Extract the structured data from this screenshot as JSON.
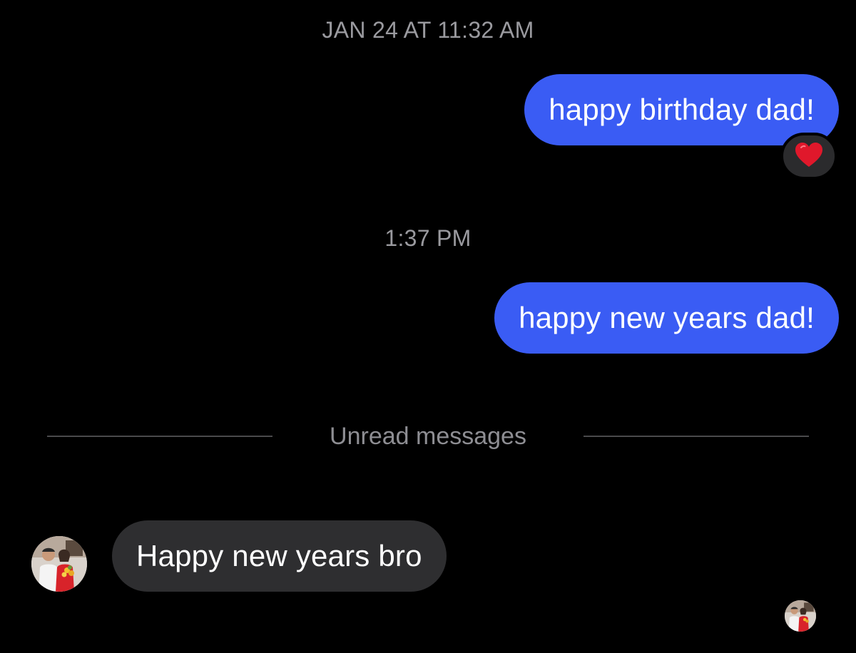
{
  "conversation": {
    "timestamps": [
      "JAN 24 AT 11:32 AM",
      "1:37 PM"
    ],
    "outgoing": [
      {
        "text": "happy birthday dad!",
        "reaction": "heart"
      },
      {
        "text": "happy new years dad!"
      }
    ],
    "divider_label": "Unread messages",
    "incoming": [
      {
        "text": "Happy new years bro"
      }
    ]
  },
  "colors": {
    "outgoing_bubble": "#3a5cf4",
    "incoming_bubble": "#2e2e30",
    "background": "#000000",
    "timestamp": "#9a9a9f",
    "reaction_heart": "#e0182b"
  },
  "icons": {
    "reaction": "red-heart-icon",
    "sender_avatar": "avatar-photo",
    "read_receipt": "read-receipt-avatar"
  }
}
